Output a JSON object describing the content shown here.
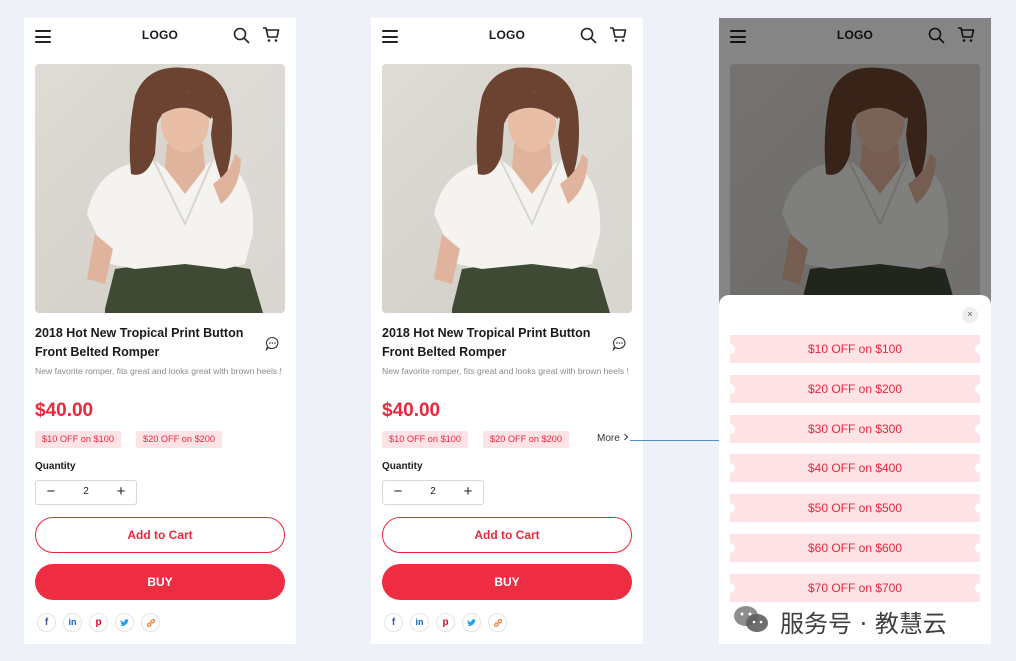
{
  "header": {
    "logo": "LOGO"
  },
  "product": {
    "title": "2018 Hot New Tropical Print Button Front Belted Romper",
    "description": "New favorite romper, fits great and looks great with brown heels !",
    "price": "$40.00",
    "coupons": [
      "$10 OFF on $100",
      "$20 OFF on $200"
    ],
    "more_label": "More",
    "quantity_label": "Quantity",
    "quantity": "2",
    "minus": "−",
    "plus": "+"
  },
  "actions": {
    "add_to_cart": "Add to Cart",
    "buy": "BUY"
  },
  "social_icons": [
    "facebook-icon",
    "linkedin-icon",
    "pinterest-icon",
    "twitter-icon",
    "link-icon"
  ],
  "coupon_sheet": {
    "close": "×",
    "items": [
      "$10 OFF on $100",
      "$20 OFF on $200",
      "$30 OFF on $300",
      "$40 OFF on $400",
      "$50 OFF on $500",
      "$60 OFF on $600",
      "$70 OFF on $700"
    ]
  },
  "watermark": "服务号 · 教慧云",
  "colors": {
    "accent": "#e8283c",
    "coupon_bg": "#fde3e6",
    "page_bg": "#eef1f8",
    "connector": "#4e8fd0"
  }
}
